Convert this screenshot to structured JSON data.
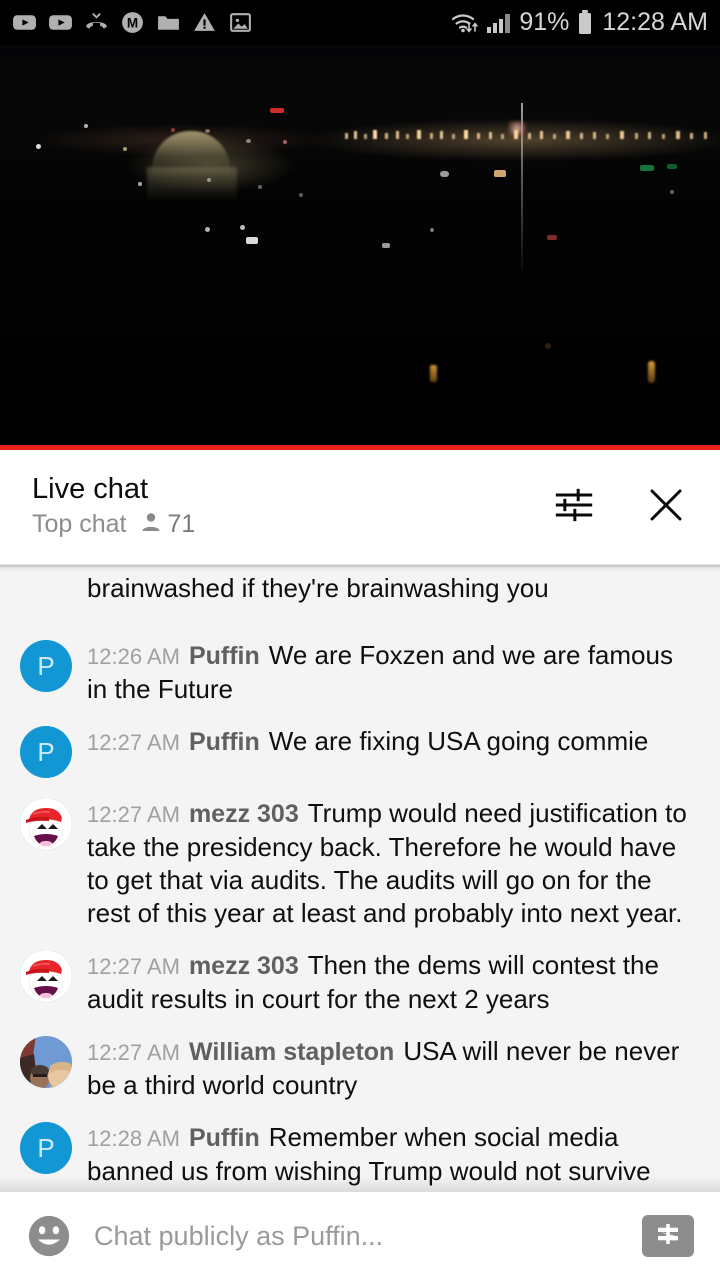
{
  "status_bar": {
    "icons": [
      "youtube-icon",
      "youtube-icon",
      "missed-call-icon",
      "m-app-icon",
      "folder-icon",
      "warning-icon",
      "image-icon"
    ],
    "right_icons": [
      "wifi-icon",
      "cellular-signal-icon",
      "battery-icon"
    ],
    "battery_percent": "91%",
    "clock": "12:28 AM"
  },
  "video": {
    "description": "night-skyline-live-stream",
    "progress_color": "#e62117"
  },
  "chat_header": {
    "title": "Live chat",
    "mode_label": "Top chat",
    "viewer_count": "71",
    "viewer_icon": "person-icon",
    "settings_icon": "tune-icon",
    "close_icon": "close-icon"
  },
  "messages": [
    {
      "partial": true,
      "avatar_type": "none",
      "time": "",
      "author": "",
      "text": "brainwashed if they're brainwashing you"
    },
    {
      "partial": false,
      "avatar_type": "letter",
      "avatar_letter": "P",
      "avatar_color": "#1296d4",
      "time": "12:26 AM",
      "author": "Puffin",
      "text": "We are Foxzen and we are famous in the Future"
    },
    {
      "partial": false,
      "avatar_type": "letter",
      "avatar_letter": "P",
      "avatar_color": "#1296d4",
      "time": "12:27 AM",
      "author": "Puffin",
      "text": "We are fixing USA going commie"
    },
    {
      "partial": false,
      "avatar_type": "meme",
      "time": "12:27 AM",
      "author": "mezz 303",
      "text": "Trump would need justification to take the presidency back. Therefore he would have to get that via audits. The audits will go on for the rest of this year at least and probably into next year."
    },
    {
      "partial": false,
      "avatar_type": "meme",
      "time": "12:27 AM",
      "author": "mezz 303",
      "text": "Then the dems will contest the audit results in court for the next 2 years"
    },
    {
      "partial": false,
      "avatar_type": "photo",
      "time": "12:27 AM",
      "author": "William stapleton",
      "text": "USA will never be never be a third world country"
    },
    {
      "partial": false,
      "avatar_type": "letter",
      "avatar_letter": "P",
      "avatar_color": "#1296d4",
      "time": "12:28 AM",
      "author": "Puffin",
      "text": "Remember when social media banned us from wishing Trump would not survive Trumpvirus?"
    }
  ],
  "input_bar": {
    "emoji_icon": "emoji-smiley-icon",
    "placeholder": "Chat publicly as Puffin...",
    "value": "",
    "superchat_icon": "dollar-icon"
  }
}
